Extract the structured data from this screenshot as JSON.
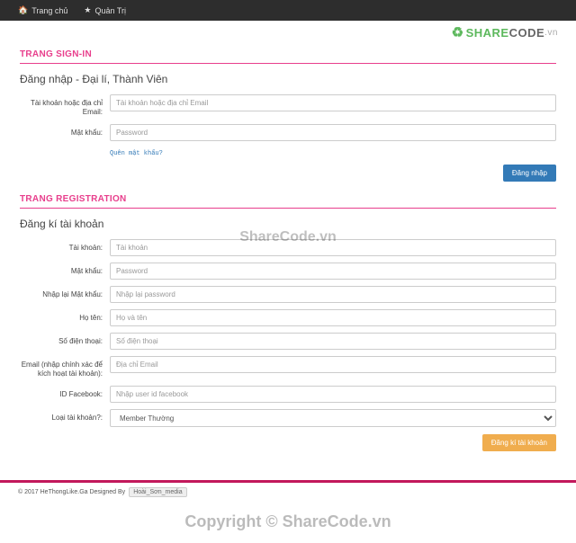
{
  "nav": {
    "home": "Trang chủ",
    "admin": "Quản Trị"
  },
  "brand": {
    "share": "SHARE",
    "code": "CODE",
    "vn": ".vn"
  },
  "signin": {
    "section_title": "TRANG SIGN-IN",
    "heading": "Đăng nhập - Đại lí, Thành Viên",
    "labels": {
      "email": "Tài khoản hoặc địa chỉ Email:",
      "password": "Mật khẩu:"
    },
    "placeholders": {
      "email": "Tài khoản hoặc địa chỉ Email",
      "password": "Password"
    },
    "forgot": "Quên mật khẩu?",
    "submit": "Đăng nhập"
  },
  "register": {
    "section_title": "TRANG REGISTRATION",
    "heading": "Đăng kí tài khoản",
    "labels": {
      "account": "Tài khoản:",
      "password": "Mật khẩu:",
      "password2": "Nhập lại Mật khẩu:",
      "fullname": "Họ tên:",
      "phone": "Số điện thoại:",
      "email": "Email (nhập chính xác để kích hoạt tài khoản):",
      "fbid": "ID Facebook:",
      "acctype": "Loại tài khoản?:"
    },
    "placeholders": {
      "account": "Tài khoản",
      "password": "Password",
      "password2": "Nhập lại password",
      "fullname": "Họ và tên",
      "phone": "Số điện thoại",
      "email": "Địa chỉ Email",
      "fbid": "Nhập user id facebook"
    },
    "acctype_value": "Member Thường",
    "submit": "Đăng kí tài khoản"
  },
  "footer": {
    "copyright": "© 2017 HeThongLike.Ga Designed By",
    "author": "Hoài_Sơn_media"
  },
  "watermark": {
    "wm1": "ShareCode.vn",
    "wm2": "Copyright © ShareCode.vn"
  }
}
